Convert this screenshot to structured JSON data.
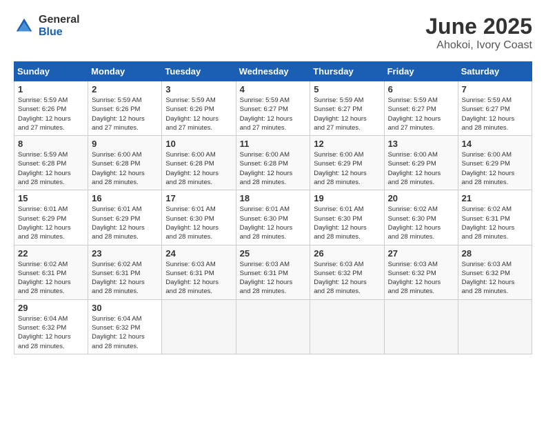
{
  "logo": {
    "general": "General",
    "blue": "Blue"
  },
  "title": "June 2025",
  "subtitle": "Ahokoi, Ivory Coast",
  "days_of_week": [
    "Sunday",
    "Monday",
    "Tuesday",
    "Wednesday",
    "Thursday",
    "Friday",
    "Saturday"
  ],
  "weeks": [
    [
      {
        "day": "1",
        "info": "Sunrise: 5:59 AM\nSunset: 6:26 PM\nDaylight: 12 hours\nand 27 minutes."
      },
      {
        "day": "2",
        "info": "Sunrise: 5:59 AM\nSunset: 6:26 PM\nDaylight: 12 hours\nand 27 minutes."
      },
      {
        "day": "3",
        "info": "Sunrise: 5:59 AM\nSunset: 6:26 PM\nDaylight: 12 hours\nand 27 minutes."
      },
      {
        "day": "4",
        "info": "Sunrise: 5:59 AM\nSunset: 6:27 PM\nDaylight: 12 hours\nand 27 minutes."
      },
      {
        "day": "5",
        "info": "Sunrise: 5:59 AM\nSunset: 6:27 PM\nDaylight: 12 hours\nand 27 minutes."
      },
      {
        "day": "6",
        "info": "Sunrise: 5:59 AM\nSunset: 6:27 PM\nDaylight: 12 hours\nand 27 minutes."
      },
      {
        "day": "7",
        "info": "Sunrise: 5:59 AM\nSunset: 6:27 PM\nDaylight: 12 hours\nand 28 minutes."
      }
    ],
    [
      {
        "day": "8",
        "info": "Sunrise: 5:59 AM\nSunset: 6:28 PM\nDaylight: 12 hours\nand 28 minutes."
      },
      {
        "day": "9",
        "info": "Sunrise: 6:00 AM\nSunset: 6:28 PM\nDaylight: 12 hours\nand 28 minutes."
      },
      {
        "day": "10",
        "info": "Sunrise: 6:00 AM\nSunset: 6:28 PM\nDaylight: 12 hours\nand 28 minutes."
      },
      {
        "day": "11",
        "info": "Sunrise: 6:00 AM\nSunset: 6:28 PM\nDaylight: 12 hours\nand 28 minutes."
      },
      {
        "day": "12",
        "info": "Sunrise: 6:00 AM\nSunset: 6:29 PM\nDaylight: 12 hours\nand 28 minutes."
      },
      {
        "day": "13",
        "info": "Sunrise: 6:00 AM\nSunset: 6:29 PM\nDaylight: 12 hours\nand 28 minutes."
      },
      {
        "day": "14",
        "info": "Sunrise: 6:00 AM\nSunset: 6:29 PM\nDaylight: 12 hours\nand 28 minutes."
      }
    ],
    [
      {
        "day": "15",
        "info": "Sunrise: 6:01 AM\nSunset: 6:29 PM\nDaylight: 12 hours\nand 28 minutes."
      },
      {
        "day": "16",
        "info": "Sunrise: 6:01 AM\nSunset: 6:29 PM\nDaylight: 12 hours\nand 28 minutes."
      },
      {
        "day": "17",
        "info": "Sunrise: 6:01 AM\nSunset: 6:30 PM\nDaylight: 12 hours\nand 28 minutes."
      },
      {
        "day": "18",
        "info": "Sunrise: 6:01 AM\nSunset: 6:30 PM\nDaylight: 12 hours\nand 28 minutes."
      },
      {
        "day": "19",
        "info": "Sunrise: 6:01 AM\nSunset: 6:30 PM\nDaylight: 12 hours\nand 28 minutes."
      },
      {
        "day": "20",
        "info": "Sunrise: 6:02 AM\nSunset: 6:30 PM\nDaylight: 12 hours\nand 28 minutes."
      },
      {
        "day": "21",
        "info": "Sunrise: 6:02 AM\nSunset: 6:31 PM\nDaylight: 12 hours\nand 28 minutes."
      }
    ],
    [
      {
        "day": "22",
        "info": "Sunrise: 6:02 AM\nSunset: 6:31 PM\nDaylight: 12 hours\nand 28 minutes."
      },
      {
        "day": "23",
        "info": "Sunrise: 6:02 AM\nSunset: 6:31 PM\nDaylight: 12 hours\nand 28 minutes."
      },
      {
        "day": "24",
        "info": "Sunrise: 6:03 AM\nSunset: 6:31 PM\nDaylight: 12 hours\nand 28 minutes."
      },
      {
        "day": "25",
        "info": "Sunrise: 6:03 AM\nSunset: 6:31 PM\nDaylight: 12 hours\nand 28 minutes."
      },
      {
        "day": "26",
        "info": "Sunrise: 6:03 AM\nSunset: 6:32 PM\nDaylight: 12 hours\nand 28 minutes."
      },
      {
        "day": "27",
        "info": "Sunrise: 6:03 AM\nSunset: 6:32 PM\nDaylight: 12 hours\nand 28 minutes."
      },
      {
        "day": "28",
        "info": "Sunrise: 6:03 AM\nSunset: 6:32 PM\nDaylight: 12 hours\nand 28 minutes."
      }
    ],
    [
      {
        "day": "29",
        "info": "Sunrise: 6:04 AM\nSunset: 6:32 PM\nDaylight: 12 hours\nand 28 minutes."
      },
      {
        "day": "30",
        "info": "Sunrise: 6:04 AM\nSunset: 6:32 PM\nDaylight: 12 hours\nand 28 minutes."
      },
      {
        "day": "",
        "info": ""
      },
      {
        "day": "",
        "info": ""
      },
      {
        "day": "",
        "info": ""
      },
      {
        "day": "",
        "info": ""
      },
      {
        "day": "",
        "info": ""
      }
    ]
  ]
}
